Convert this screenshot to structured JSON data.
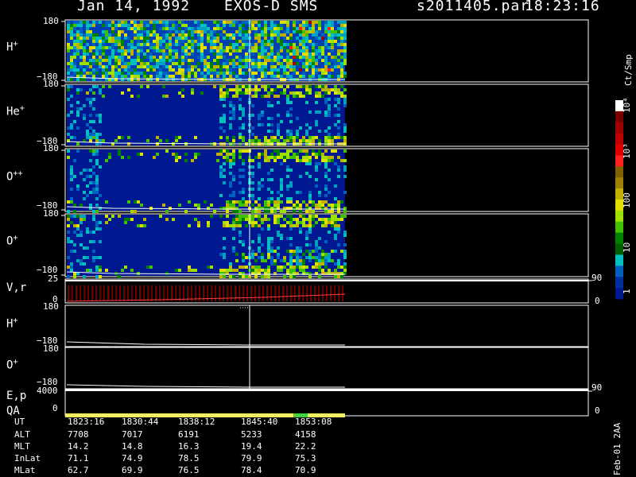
{
  "header": {
    "date": "Jan 14, 1992",
    "instrument": "EXOS-D SMS",
    "file": "s2011405.par",
    "time": "18:23:16"
  },
  "panels": [
    {
      "id": "H+",
      "label": "H",
      "sup": "+",
      "top": "180",
      "bottom": "−180"
    },
    {
      "id": "He+",
      "label": "He",
      "sup": "+",
      "top": "180",
      "bottom": "−180"
    },
    {
      "id": "O++",
      "label": "O",
      "sup": "++",
      "top": "180",
      "bottom": "−180"
    },
    {
      "id": "O+",
      "label": "O",
      "sup": "+",
      "top": "180",
      "bottom": "−180"
    }
  ],
  "vr": {
    "label": "V,r",
    "left_top": "25",
    "left_bottom": "0",
    "right_top": "90",
    "right_bottom": "0"
  },
  "lines": [
    {
      "id": "H+line",
      "label": "H",
      "sup": "+",
      "top": "180",
      "bottom": "−180"
    },
    {
      "id": "O+line",
      "label": "O",
      "sup": "+",
      "top": "180",
      "bottom": "−180"
    }
  ],
  "ep": {
    "label": "E,p",
    "left_top": "4000",
    "right_top": "90"
  },
  "qa": {
    "label": "QA",
    "left": "0",
    "right": "0"
  },
  "colorbar": {
    "unit": "Ct/Smp",
    "labels": [
      "10⁴",
      "10³",
      "100",
      "10",
      "1"
    ],
    "colors": [
      "#ffffff",
      "#7a0000",
      "#a00000",
      "#c00000",
      "#e00000",
      "#ff2020",
      "#806000",
      "#a08000",
      "#c0b000",
      "#e0e000",
      "#a0e000",
      "#40c000",
      "#008000",
      "#006000",
      "#00c0c0",
      "#0060c0",
      "#0030a0",
      "#001890"
    ]
  },
  "table": {
    "rows": [
      {
        "name": "UT",
        "values": [
          "1823:16",
          "1830:44",
          "1838:12",
          "1845:40",
          "1853:08"
        ]
      },
      {
        "name": "ALT",
        "values": [
          "7708",
          "7017",
          "6191",
          "5233",
          "4158"
        ]
      },
      {
        "name": "MLT",
        "values": [
          "14.2",
          "14.8",
          "16.3",
          "19.4",
          "22.2"
        ]
      },
      {
        "name": "InLat",
        "values": [
          "71.1",
          "74.9",
          "78.5",
          "79.9",
          "75.3"
        ]
      },
      {
        "name": "MLat",
        "values": [
          "62.7",
          "69.9",
          "76.5",
          "78.4",
          "70.9"
        ]
      }
    ]
  },
  "stamp": "Feb-01 2AA",
  "chart_data": {
    "type": "heatmap",
    "title": "Jan 14, 1992   EXOS-D SMS",
    "x_ticks": [
      "1823:16",
      "1830:44",
      "1838:12",
      "1845:40",
      "1853:08"
    ],
    "ylim": [
      -180,
      180
    ],
    "zscale": "log",
    "zlim": [
      1,
      10000
    ],
    "zunit": "Ct/Smp",
    "species": [
      "H+",
      "He+",
      "O++",
      "O+"
    ],
    "grid": false
  }
}
